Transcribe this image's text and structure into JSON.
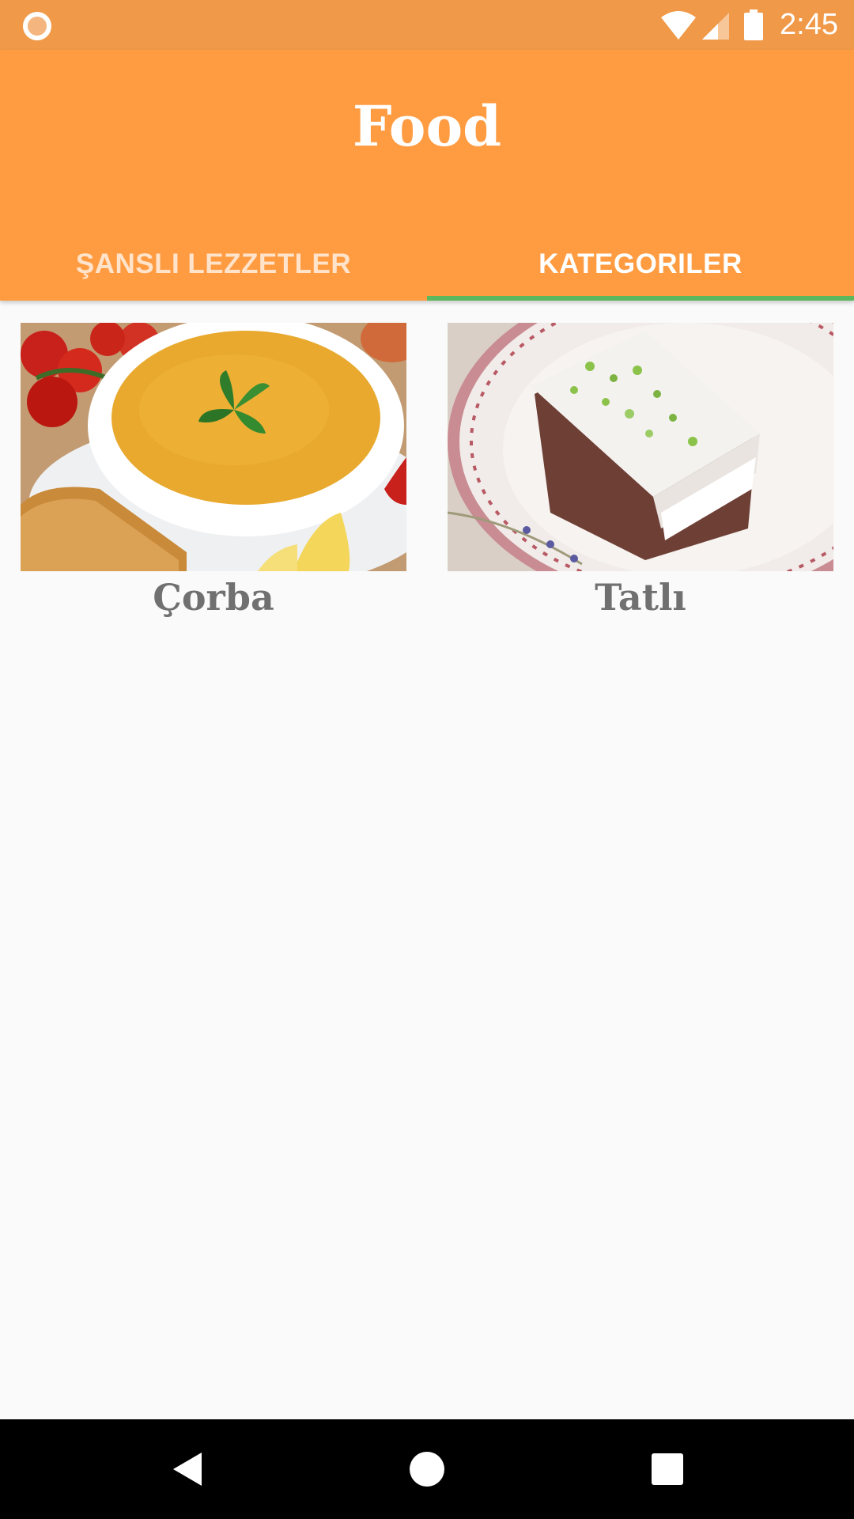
{
  "status_bar": {
    "time": "2:45",
    "icons": [
      "notification-ring-icon",
      "wifi-icon",
      "signal-icon",
      "battery-icon"
    ]
  },
  "app_bar": {
    "title": "Food",
    "background": "#ff9c42"
  },
  "tabs": [
    {
      "label": "ŞANSLI LEZZETLER",
      "active": false
    },
    {
      "label": "KATEGORILER",
      "active": true
    }
  ],
  "categories": [
    {
      "label": "Çorba",
      "image": "soup-photo"
    },
    {
      "label": "Tatlı",
      "image": "dessert-photo"
    }
  ],
  "navigation": {
    "buttons": [
      "back-icon",
      "home-icon",
      "recents-icon"
    ]
  },
  "colors": {
    "status_bar": "#f09948",
    "accent_indicator": "#5cb85c",
    "label_text": "#707070"
  }
}
